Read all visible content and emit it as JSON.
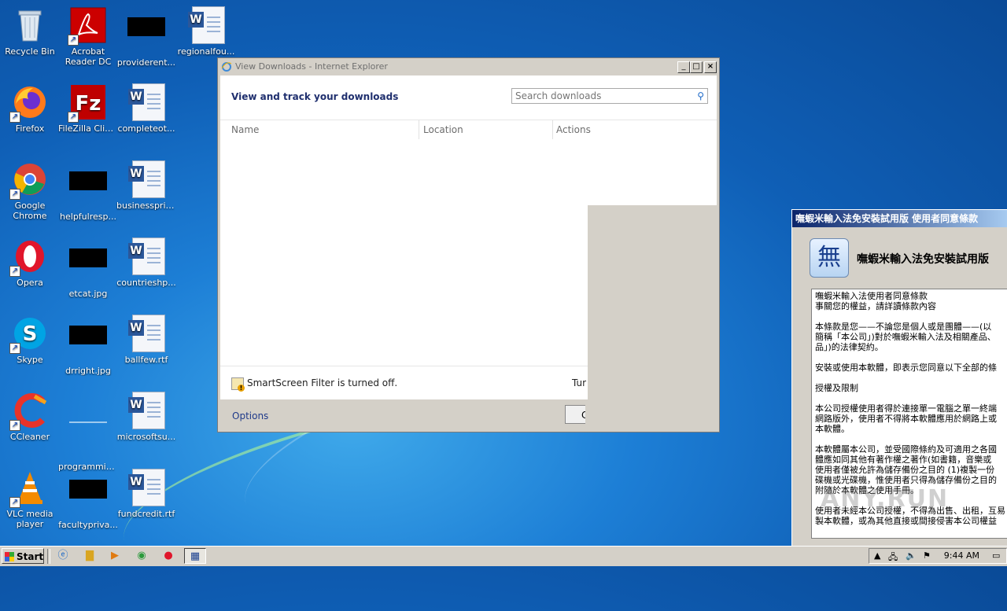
{
  "desktop": {
    "icons": [
      {
        "label": "Recycle Bin"
      },
      {
        "label": "Acrobat Reader DC"
      },
      {
        "label": "providerent..."
      },
      {
        "label": "regionalfou..."
      },
      {
        "label": "Firefox"
      },
      {
        "label": "FileZilla Client"
      },
      {
        "label": "completeot..."
      },
      {
        "label": "Google Chrome"
      },
      {
        "label": "helpfulresp..."
      },
      {
        "label": "businessprin..."
      },
      {
        "label": "Opera"
      },
      {
        "label": "etcat.jpg"
      },
      {
        "label": "countrieshp..."
      },
      {
        "label": "Skype"
      },
      {
        "label": "drright.jpg"
      },
      {
        "label": "ballfew.rtf"
      },
      {
        "label": "CCleaner"
      },
      {
        "label": "programmin..."
      },
      {
        "label": "microsoftsu..."
      },
      {
        "label": "VLC media player"
      },
      {
        "label": "facultypriva..."
      },
      {
        "label": "fundcredit.rtf"
      }
    ]
  },
  "ie_window": {
    "title": "View Downloads - Internet Explorer",
    "header": "View and track your downloads",
    "search_placeholder": "Search downloads",
    "columns": [
      "Name",
      "Location",
      "Actions"
    ],
    "smartscreen": "SmartScreen Filter is turned off.",
    "turn_link": "Tur",
    "options": "Options",
    "close_partial": "C"
  },
  "installer": {
    "title": "嘸蝦米輸入法免安裝試用版 使用者同意條款",
    "heading": "嘸蝦米輸入法免安裝試用版",
    "logo_char": "無",
    "license_paragraphs": [
      "嘸蝦米輸入法使用者同意條款\n事關您的權益，請詳讀條款內容",
      "本條款是您——不論您是個人或是團體——(以\n簡稱「本公司」)對於嘸蝦米輸入法及相關產品、\n品」)的法律契約。",
      "安裝或使用本軟體，即表示您同意以下全部的條",
      "授權及限制",
      "本公司授權使用者得於連接單一電腦之單一終端\n網路版外，使用者不得將本軟體應用於網路上或\n本軟體。",
      "本軟體屬本公司，並受國際條約及可適用之各國\n體應如同其他有著作權之著作(如書籍，音樂或\n使用者僅被允許為儲存備份之目的 (1)複製一份\n碟機或光碟機，惟使用者只得為儲存備份之目的\n附隨於本軟體之使用手冊。",
      "使用者未經本公司授權，不得為出售、出租，互易\n製本軟體，或為其他直接或間接侵害本公司權益"
    ],
    "watermark": "ANY.RUN"
  },
  "taskbar": {
    "start_label": "Start",
    "clock": "9:44 AM"
  }
}
